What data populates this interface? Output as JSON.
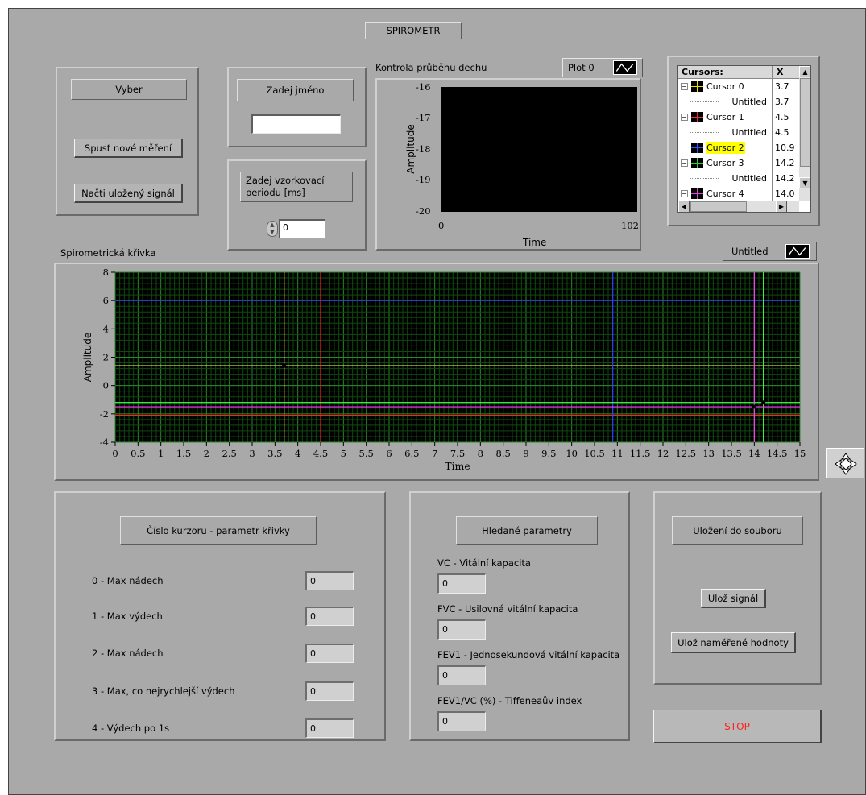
{
  "title": "SPIROMETR",
  "vyber": {
    "label": "Vyber",
    "new_measure_button": "Spusť nové měření",
    "load_signal_button": "Načti uložený signál"
  },
  "name": {
    "label": "Zadej jméno",
    "value": ""
  },
  "period": {
    "label": "Zadej vzorkovací periodu [ms]",
    "value": "0"
  },
  "small_graph": {
    "title": "Kontrola průběhu dechu",
    "legend": "Plot 0",
    "ylabel": "Amplitude",
    "xlabel": "Time",
    "yticks": [
      "-16",
      "-17",
      "-18",
      "-19",
      "-20"
    ],
    "xticks": [
      "0",
      "102"
    ]
  },
  "cursors": {
    "header_name": "Cursors:",
    "header_x": "X",
    "rows": [
      {
        "name": "Cursor 0",
        "x": "3.7",
        "color": "#f0e000",
        "sub": false
      },
      {
        "name": "Untitled",
        "x": "3.7",
        "sub": true
      },
      {
        "name": "Cursor 1",
        "x": "4.5",
        "color": "#e03030",
        "sub": false
      },
      {
        "name": "Untitled",
        "x": "4.5",
        "sub": true
      },
      {
        "name": "Cursor 2",
        "x": "10.9",
        "color": "#3050ff",
        "sub": false,
        "selected": true
      },
      {
        "name": "Cursor 3",
        "x": "14.2",
        "color": "#30d030",
        "sub": false
      },
      {
        "name": "Untitled",
        "x": "14.2",
        "sub": true
      },
      {
        "name": "Cursor 4",
        "x": "14.0",
        "color": "#e040e0",
        "sub": false
      }
    ]
  },
  "main_graph": {
    "title": "Spirometrická křivka",
    "legend": "Untitled",
    "ylabel": "Amplitude",
    "xlabel": "Time"
  },
  "chart_data": {
    "type": "line",
    "title": "Spirometrická křivka",
    "xlabel": "Time",
    "ylabel": "Amplitude",
    "xlim": [
      0,
      15
    ],
    "ylim": [
      -4,
      8
    ],
    "xticks": [
      "0",
      "0.5",
      "1",
      "1.5",
      "2",
      "2.5",
      "3",
      "3.5",
      "4",
      "4.5",
      "5",
      "5.5",
      "6",
      "6.5",
      "7",
      "7.5",
      "8",
      "8.5",
      "9",
      "9.5",
      "10",
      "10.5",
      "11",
      "11.5",
      "12",
      "12.5",
      "13",
      "13.5",
      "14",
      "14.5",
      "15"
    ],
    "yticks": [
      "8",
      "6",
      "4",
      "2",
      "0",
      "-2",
      "-4"
    ],
    "grid": true,
    "cursors": [
      {
        "name": "Cursor 0",
        "x": 3.7,
        "y": 1.4,
        "color": "#ffff60"
      },
      {
        "name": "Cursor 1",
        "x": 4.5,
        "y": -2.1,
        "color": "#ff2020"
      },
      {
        "name": "Cursor 2",
        "x": 10.9,
        "y": 6.0,
        "color": "#3040ff"
      },
      {
        "name": "Cursor 3",
        "x": 14.2,
        "y": -1.2,
        "color": "#40ff40"
      },
      {
        "name": "Cursor 4",
        "x": 14.0,
        "y": -1.5,
        "color": "#ff40ff"
      }
    ]
  },
  "cursor_params": {
    "label": "Číslo kurzoru - parametr křivky",
    "items": [
      {
        "label": "0 - Max nádech",
        "value": "0"
      },
      {
        "label": "1 - Max výdech",
        "value": "0"
      },
      {
        "label": "2 - Max nádech",
        "value": "0"
      },
      {
        "label": "3 - Max, co nejrychlejší výdech",
        "value": "0"
      },
      {
        "label": "4 - Výdech po 1s",
        "value": "0"
      }
    ]
  },
  "params": {
    "label": "Hledané parametry",
    "items": [
      {
        "label": "VC - Vitální kapacita",
        "value": "0"
      },
      {
        "label": "FVC - Usilovná vitální kapacita",
        "value": "0"
      },
      {
        "label": "FEV1 - Jednosekundová vitální kapacita",
        "value": "0"
      },
      {
        "label": "FEV1/VC (%) - Tiffeneaův index",
        "value": "0"
      }
    ]
  },
  "save": {
    "label": "Uložení do souboru",
    "save_signal_button": "Ulož signál",
    "save_values_button": "Ulož naměřené hodnoty"
  },
  "stop_button": "STOP",
  "colors": {
    "panel": "#a9a9a9",
    "plot_bg": "#000000",
    "grid": "#1f7a1f",
    "stop_text": "#ff2020",
    "selected": "#ffff00"
  }
}
